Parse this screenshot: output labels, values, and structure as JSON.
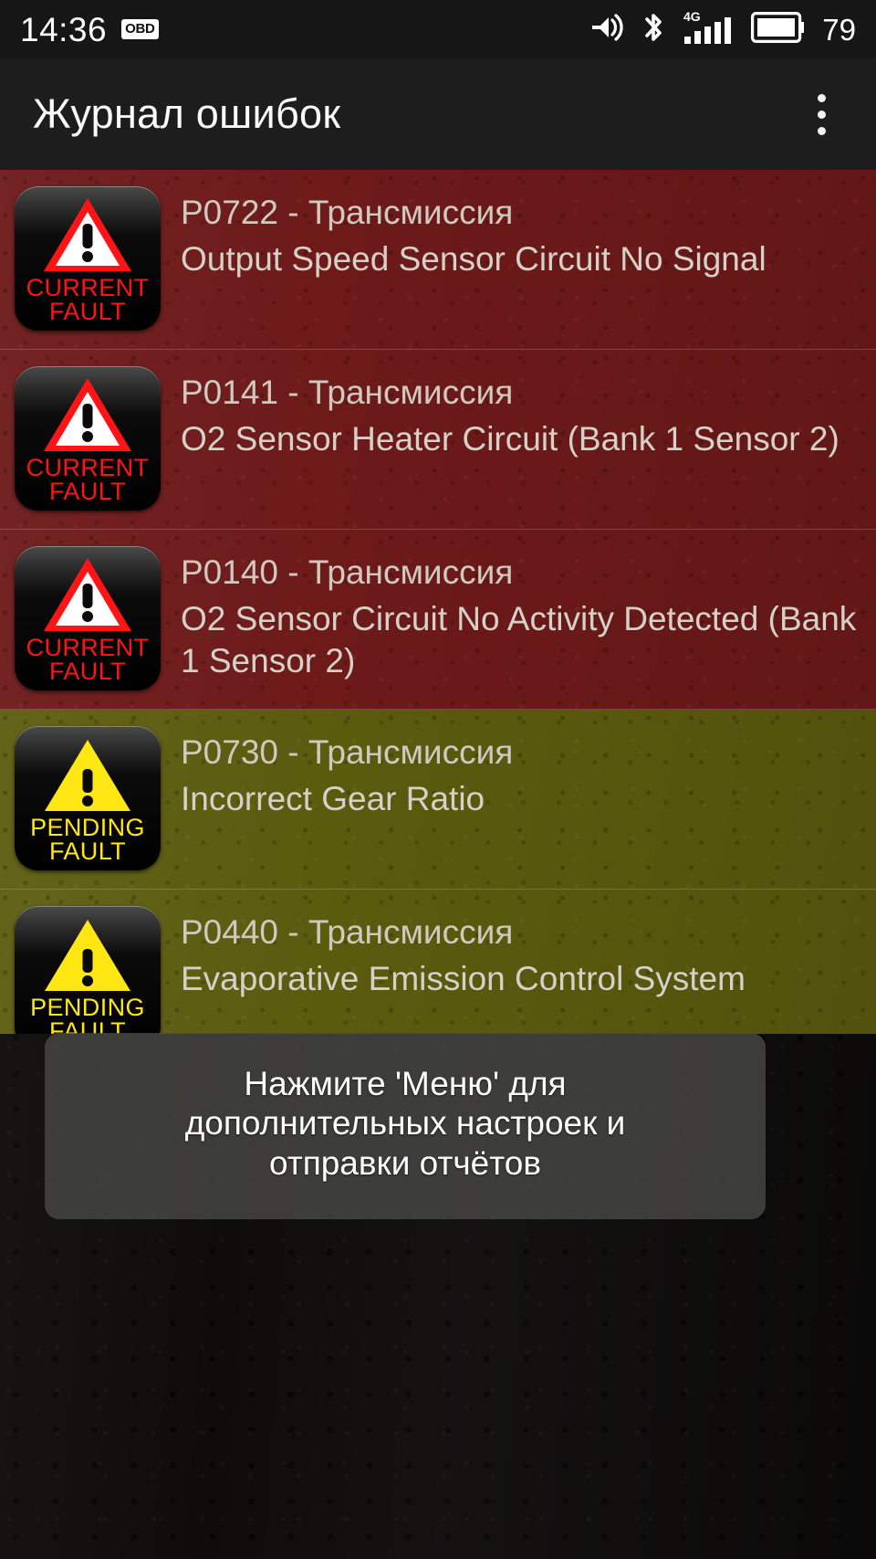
{
  "status_bar": {
    "time": "14:36",
    "obd_badge_label": "OBD",
    "battery_percent": "79",
    "icons": [
      "vibrate-icon",
      "bluetooth-icon",
      "signal-4g-icon",
      "battery-icon"
    ],
    "network_label": "4G"
  },
  "action_bar": {
    "title": "Журнал ошибок",
    "overflow_menu_name": "more-options"
  },
  "faults": [
    {
      "code": "P0722 - Трансмиссия",
      "description": "Output Speed Sensor Circuit No Signal",
      "status": "current",
      "badge_line1": "CURRENT",
      "badge_line2": "FAULT",
      "row_color": "#6d1a19",
      "badge_color": "#ff1416"
    },
    {
      "code": "P0141 - Трансмиссия",
      "description": "O2 Sensor Heater Circuit (Bank 1 Sensor 2)",
      "status": "current",
      "badge_line1": "CURRENT",
      "badge_line2": "FAULT",
      "row_color": "#6d1a19",
      "badge_color": "#ff1416"
    },
    {
      "code": "P0140 - Трансмиссия",
      "description": "O2 Sensor Circuit No Activity Detected (Bank 1 Sensor 2)",
      "status": "current",
      "badge_line1": "CURRENT",
      "badge_line2": "FAULT",
      "row_color": "#6d1a19",
      "badge_color": "#ff1416"
    },
    {
      "code": "P0730 - Трансмиссия",
      "description": "Incorrect Gear Ratio",
      "status": "pending",
      "badge_line1": "PENDING",
      "badge_line2": "FAULT",
      "row_color": "#5b5b0e",
      "badge_color": "#ffe714"
    },
    {
      "code": "P0440 - Трансмиссия",
      "description": "Evaporative Emission Control System",
      "status": "pending",
      "badge_line1": "PENDING",
      "badge_line2": "FAULT",
      "row_color": "#5b5b0e",
      "badge_color": "#ffe714"
    }
  ],
  "toast": {
    "line1": "Нажмите 'Меню' для",
    "line2": "дополнительных настроек и",
    "line3": "отправки отчётов"
  }
}
